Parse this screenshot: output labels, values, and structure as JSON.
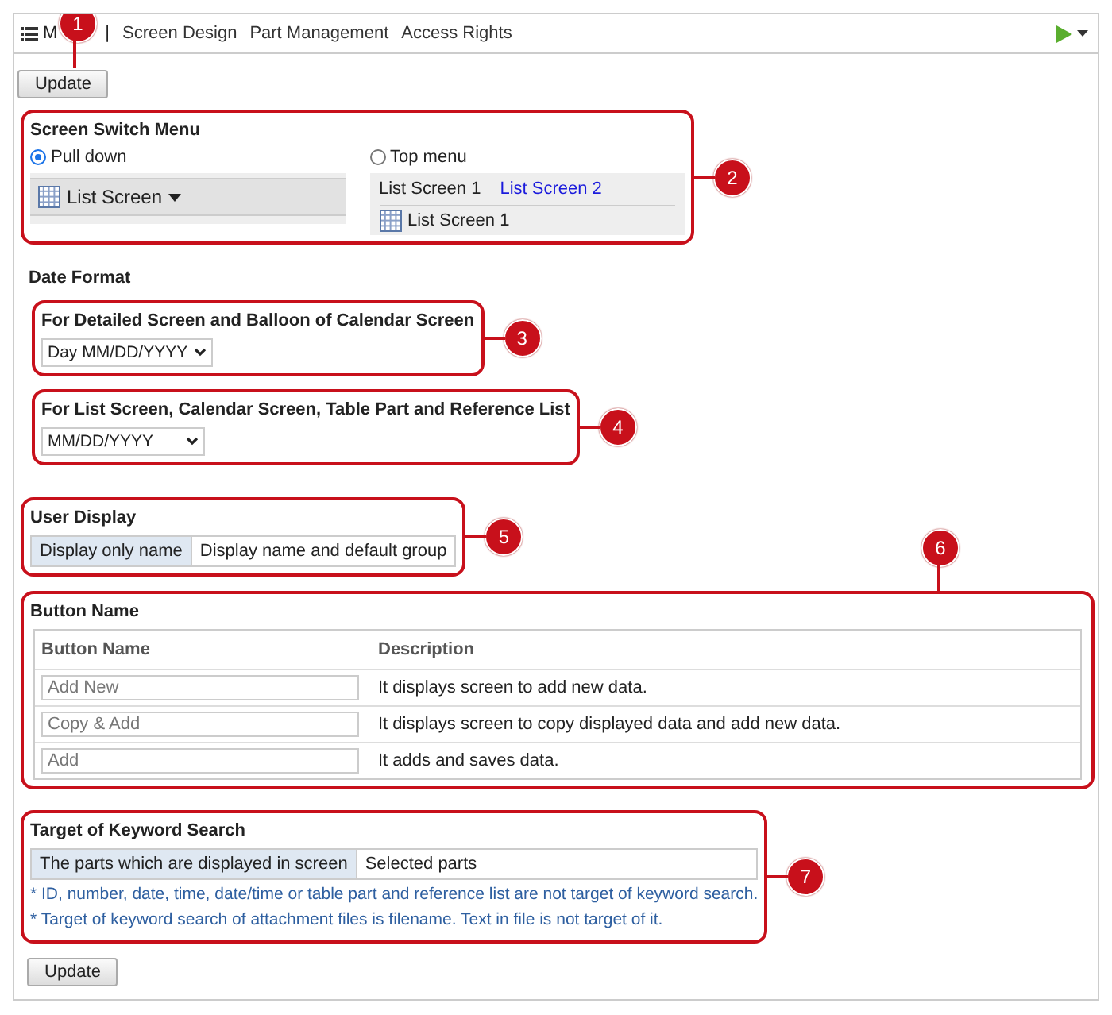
{
  "toolbar": {
    "menu_label": "M",
    "separator": "|",
    "links": [
      "Screen Design",
      "Part Management",
      "Access Rights"
    ],
    "callout": "1"
  },
  "update_top": "Update",
  "screen_switch_menu": {
    "title": "Screen Switch Menu",
    "callout": "2",
    "options": [
      {
        "label": "Pull down",
        "selected": true,
        "preview": {
          "kind": "pulldown",
          "label": "List Screen"
        }
      },
      {
        "label": "Top menu",
        "selected": false,
        "preview": {
          "kind": "topmenu",
          "tabs": [
            {
              "label": "List Screen 1",
              "selected": true
            },
            {
              "label": "List Screen 2",
              "selected": false
            }
          ],
          "item": "List Screen 1"
        }
      }
    ]
  },
  "date_format": {
    "title": "Date Format",
    "groups": [
      {
        "title": "For Detailed Screen and Balloon of Calendar Screen",
        "value": "Day MM/DD/YYYY",
        "callout": "3"
      },
      {
        "title": "For List Screen, Calendar Screen, Table Part and Reference List",
        "value": "MM/DD/YYYY",
        "callout": "4"
      }
    ]
  },
  "user_display": {
    "title": "User Display",
    "callout": "5",
    "options": [
      {
        "label": "Display only name",
        "selected": true
      },
      {
        "label": "Display name and default group",
        "selected": false
      }
    ]
  },
  "button_name": {
    "title": "Button Name",
    "callout": "6",
    "columns": [
      "Button Name",
      "Description"
    ],
    "rows": [
      {
        "placeholder": "Add New",
        "description": "It displays screen to add new data."
      },
      {
        "placeholder": "Copy & Add",
        "description": "It displays screen to copy displayed data and add new data."
      },
      {
        "placeholder": "Add",
        "description": "It adds and saves data."
      }
    ]
  },
  "keyword_search": {
    "title": "Target of Keyword Search",
    "callout": "7",
    "options": [
      {
        "label": "The parts which are displayed in screen",
        "selected": true
      },
      {
        "label": "Selected parts",
        "selected": false
      }
    ],
    "notes": [
      "* ID, number, date, time, date/time or table part and reference list are not target of keyword search.",
      "* Target of keyword search of attachment files is filename. Text in file is not target of it."
    ]
  },
  "update_bottom": "Update"
}
